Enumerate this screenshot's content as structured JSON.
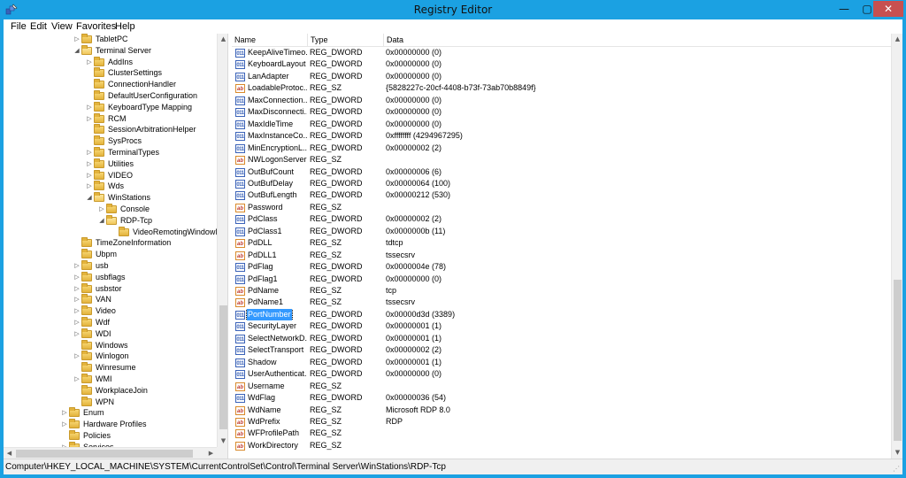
{
  "window": {
    "title": "Registry Editor",
    "controls": {
      "minimize": "—",
      "maximize": "▢",
      "close": "✕"
    }
  },
  "menu": [
    "File",
    "Edit",
    "View",
    "Favorites",
    "Help"
  ],
  "tree": [
    {
      "label": "TabletPC",
      "level": 1,
      "arrow": "▷"
    },
    {
      "label": "Terminal Server",
      "level": 1,
      "arrow": "◢",
      "open": true
    },
    {
      "label": "AddIns",
      "level": 2,
      "arrow": "▷"
    },
    {
      "label": "ClusterSettings",
      "level": 2,
      "arrow": ""
    },
    {
      "label": "ConnectionHandler",
      "level": 2,
      "arrow": ""
    },
    {
      "label": "DefaultUserConfiguration",
      "level": 2,
      "arrow": ""
    },
    {
      "label": "KeyboardType Mapping",
      "level": 2,
      "arrow": "▷"
    },
    {
      "label": "RCM",
      "level": 2,
      "arrow": "▷"
    },
    {
      "label": "SessionArbitrationHelper",
      "level": 2,
      "arrow": ""
    },
    {
      "label": "SysProcs",
      "level": 2,
      "arrow": ""
    },
    {
      "label": "TerminalTypes",
      "level": 2,
      "arrow": "▷"
    },
    {
      "label": "Utilities",
      "level": 2,
      "arrow": "▷"
    },
    {
      "label": "VIDEO",
      "level": 2,
      "arrow": "▷"
    },
    {
      "label": "Wds",
      "level": 2,
      "arrow": "▷"
    },
    {
      "label": "WinStations",
      "level": 2,
      "arrow": "◢",
      "open": true
    },
    {
      "label": "Console",
      "level": 3,
      "arrow": "▷"
    },
    {
      "label": "RDP-Tcp",
      "level": 3,
      "arrow": "◢",
      "open": true,
      "selected": true
    },
    {
      "label": "VideoRemotingWindowN",
      "level": 4,
      "arrow": ""
    },
    {
      "label": "TimeZoneInformation",
      "level": 1,
      "arrow": ""
    },
    {
      "label": "Ubpm",
      "level": 1,
      "arrow": ""
    },
    {
      "label": "usb",
      "level": 1,
      "arrow": "▷"
    },
    {
      "label": "usbflags",
      "level": 1,
      "arrow": "▷"
    },
    {
      "label": "usbstor",
      "level": 1,
      "arrow": "▷"
    },
    {
      "label": "VAN",
      "level": 1,
      "arrow": "▷"
    },
    {
      "label": "Video",
      "level": 1,
      "arrow": "▷"
    },
    {
      "label": "Wdf",
      "level": 1,
      "arrow": "▷"
    },
    {
      "label": "WDI",
      "level": 1,
      "arrow": "▷"
    },
    {
      "label": "Windows",
      "level": 1,
      "arrow": ""
    },
    {
      "label": "Winlogon",
      "level": 1,
      "arrow": "▷"
    },
    {
      "label": "Winresume",
      "level": 1,
      "arrow": ""
    },
    {
      "label": "WMI",
      "level": 1,
      "arrow": "▷"
    },
    {
      "label": "WorkplaceJoin",
      "level": 1,
      "arrow": ""
    },
    {
      "label": "WPN",
      "level": 1,
      "arrow": ""
    },
    {
      "label": "Enum",
      "level": 0,
      "arrow": "▷"
    },
    {
      "label": "Hardware Profiles",
      "level": 0,
      "arrow": "▷"
    },
    {
      "label": "Policies",
      "level": 0,
      "arrow": ""
    },
    {
      "label": "Services",
      "level": 0,
      "arrow": "▷"
    }
  ],
  "list": {
    "columns": [
      "Name",
      "Type",
      "Data"
    ],
    "rows": [
      {
        "name": "KeepAliveTimeo...",
        "type": "REG_DWORD",
        "data": "0x00000000 (0)",
        "icon": "bin"
      },
      {
        "name": "KeyboardLayout",
        "type": "REG_DWORD",
        "data": "0x00000000 (0)",
        "icon": "bin"
      },
      {
        "name": "LanAdapter",
        "type": "REG_DWORD",
        "data": "0x00000000 (0)",
        "icon": "bin"
      },
      {
        "name": "LoadableProtoc...",
        "type": "REG_SZ",
        "data": "{5828227c-20cf-4408-b73f-73ab70b8849f}",
        "icon": "str"
      },
      {
        "name": "MaxConnection...",
        "type": "REG_DWORD",
        "data": "0x00000000 (0)",
        "icon": "bin"
      },
      {
        "name": "MaxDisconnecti...",
        "type": "REG_DWORD",
        "data": "0x00000000 (0)",
        "icon": "bin"
      },
      {
        "name": "MaxIdleTime",
        "type": "REG_DWORD",
        "data": "0x00000000 (0)",
        "icon": "bin"
      },
      {
        "name": "MaxInstanceCo...",
        "type": "REG_DWORD",
        "data": "0xffffffff (4294967295)",
        "icon": "bin"
      },
      {
        "name": "MinEncryptionL...",
        "type": "REG_DWORD",
        "data": "0x00000002 (2)",
        "icon": "bin"
      },
      {
        "name": "NWLogonServer",
        "type": "REG_SZ",
        "data": "",
        "icon": "str"
      },
      {
        "name": "OutBufCount",
        "type": "REG_DWORD",
        "data": "0x00000006 (6)",
        "icon": "bin"
      },
      {
        "name": "OutBufDelay",
        "type": "REG_DWORD",
        "data": "0x00000064 (100)",
        "icon": "bin"
      },
      {
        "name": "OutBufLength",
        "type": "REG_DWORD",
        "data": "0x00000212 (530)",
        "icon": "bin"
      },
      {
        "name": "Password",
        "type": "REG_SZ",
        "data": "",
        "icon": "str"
      },
      {
        "name": "PdClass",
        "type": "REG_DWORD",
        "data": "0x00000002 (2)",
        "icon": "bin"
      },
      {
        "name": "PdClass1",
        "type": "REG_DWORD",
        "data": "0x0000000b (11)",
        "icon": "bin"
      },
      {
        "name": "PdDLL",
        "type": "REG_SZ",
        "data": "tdtcp",
        "icon": "str"
      },
      {
        "name": "PdDLL1",
        "type": "REG_SZ",
        "data": "tssecsrv",
        "icon": "str"
      },
      {
        "name": "PdFlag",
        "type": "REG_DWORD",
        "data": "0x0000004e (78)",
        "icon": "bin"
      },
      {
        "name": "PdFlag1",
        "type": "REG_DWORD",
        "data": "0x00000000 (0)",
        "icon": "bin"
      },
      {
        "name": "PdName",
        "type": "REG_SZ",
        "data": "tcp",
        "icon": "str"
      },
      {
        "name": "PdName1",
        "type": "REG_SZ",
        "data": "tssecsrv",
        "icon": "str"
      },
      {
        "name": "PortNumber",
        "type": "REG_DWORD",
        "data": "0x00000d3d (3389)",
        "icon": "bin",
        "selected": true
      },
      {
        "name": "SecurityLayer",
        "type": "REG_DWORD",
        "data": "0x00000001 (1)",
        "icon": "bin"
      },
      {
        "name": "SelectNetworkD...",
        "type": "REG_DWORD",
        "data": "0x00000001 (1)",
        "icon": "bin"
      },
      {
        "name": "SelectTransport",
        "type": "REG_DWORD",
        "data": "0x00000002 (2)",
        "icon": "bin"
      },
      {
        "name": "Shadow",
        "type": "REG_DWORD",
        "data": "0x00000001 (1)",
        "icon": "bin"
      },
      {
        "name": "UserAuthenticat...",
        "type": "REG_DWORD",
        "data": "0x00000000 (0)",
        "icon": "bin"
      },
      {
        "name": "Username",
        "type": "REG_SZ",
        "data": "",
        "icon": "str"
      },
      {
        "name": "WdFlag",
        "type": "REG_DWORD",
        "data": "0x00000036 (54)",
        "icon": "bin"
      },
      {
        "name": "WdName",
        "type": "REG_SZ",
        "data": "Microsoft RDP 8.0",
        "icon": "str"
      },
      {
        "name": "WdPrefix",
        "type": "REG_SZ",
        "data": "RDP",
        "icon": "str"
      },
      {
        "name": "WFProfilePath",
        "type": "REG_SZ",
        "data": "",
        "icon": "str"
      },
      {
        "name": "WorkDirectory",
        "type": "REG_SZ",
        "data": "",
        "icon": "str"
      }
    ]
  },
  "icon_glyphs": {
    "bin": "011",
    "str": "ab"
  },
  "statusbar": {
    "path": "Computer\\HKEY_LOCAL_MACHINE\\SYSTEM\\CurrentControlSet\\Control\\Terminal Server\\WinStations\\RDP-Tcp"
  },
  "colors": {
    "titlebar": "#1ba1e2",
    "selection": "#3399ff",
    "close_button": "#c75050"
  }
}
